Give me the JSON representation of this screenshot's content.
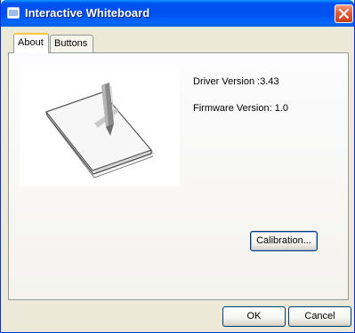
{
  "window": {
    "title": "Interactive Whiteboard"
  },
  "tabs": [
    {
      "label": "About",
      "active": true
    },
    {
      "label": "Buttons",
      "active": false
    }
  ],
  "about": {
    "driver_version": "Driver Version :3.43",
    "firmware_version": "Firmware Version: 1.0",
    "calibration_label": "Calibration..."
  },
  "footer": {
    "ok_label": "OK",
    "cancel_label": "Cancel"
  },
  "colors": {
    "titlebar": "#0054e3",
    "dialog_bg": "#ece9d8",
    "close_button": "#e35b36"
  },
  "icons": {
    "title": "window-icon",
    "close": "close-icon",
    "preview": "whiteboard-pen-illustration"
  }
}
